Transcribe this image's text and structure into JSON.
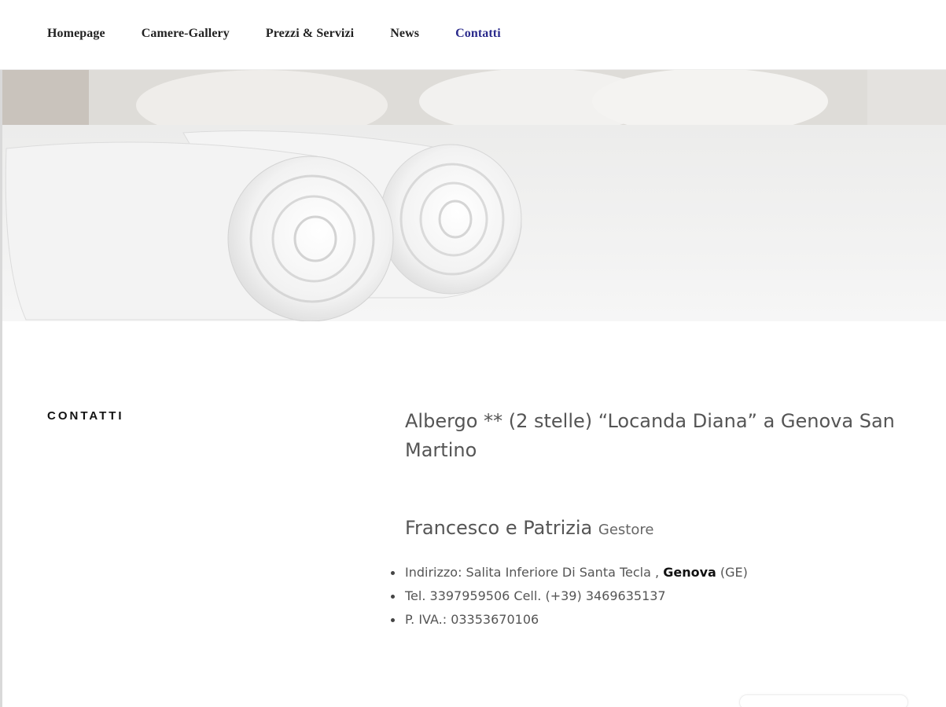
{
  "nav": {
    "items": [
      {
        "label": "Homepage",
        "active": false
      },
      {
        "label": "Camere-Gallery",
        "active": false
      },
      {
        "label": "Prezzi & Servizi",
        "active": false
      },
      {
        "label": "News",
        "active": false
      },
      {
        "label": "Contatti",
        "active": true
      }
    ],
    "active_color": "#2b2b8c"
  },
  "hero": {
    "image": "rolled-white-towels-on-bed"
  },
  "sidebar": {
    "label": "CONTATTI"
  },
  "content": {
    "title": "Albergo ** (2 stelle) “Locanda Diana” a  Genova San Martino",
    "managers": "Francesco e Patrizia",
    "manager_role": "Gestore",
    "address_prefix": "Indirizzo: Salita Inferiore Di Santa Tecla ,",
    "address_city": "Genova",
    "address_suffix": "(GE)",
    "phone": "Tel. 3397959506  Cell. (+39) 3469635137",
    "vat": "P. IVA.:  03353670106"
  }
}
